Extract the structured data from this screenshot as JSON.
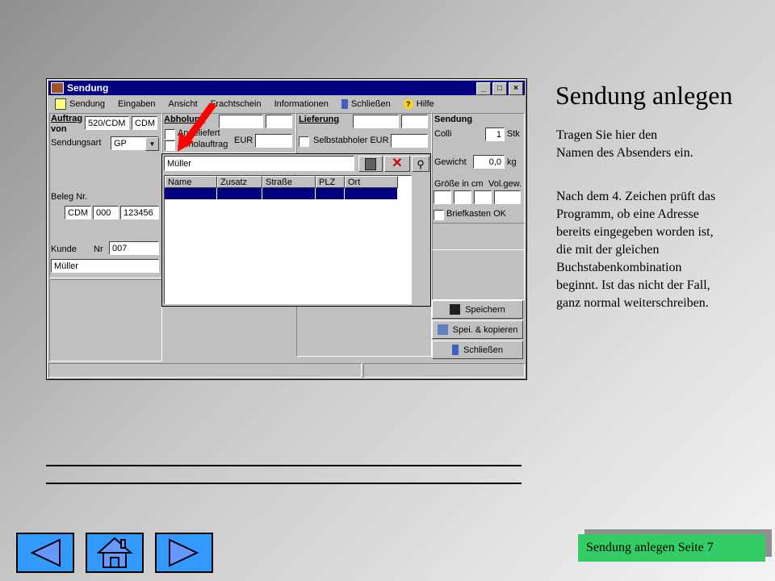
{
  "window": {
    "title": "Sendung",
    "controls": [
      "_",
      "□",
      "×"
    ],
    "menu": [
      {
        "label": "Sendung",
        "icon": "document-icon"
      },
      {
        "label": "Eingaben"
      },
      {
        "label": "Ansicht"
      },
      {
        "label": "Frachtschein"
      },
      {
        "label": "Informationen"
      },
      {
        "label": "Schließen",
        "icon": "door-icon"
      },
      {
        "label": "Hilfe",
        "icon": "help-icon"
      }
    ]
  },
  "auftrag": {
    "label_line1": "Auftrag",
    "label_line2": "von",
    "auftrag_nr": "520/CDM",
    "auftrag_code": "CDM",
    "sendungsart_label": "Sendungsart",
    "sendungsart_value": "GP",
    "beleg_label": "Beleg Nr.",
    "beleg_1": "CDM",
    "beleg_2": "000",
    "beleg_3": "123456",
    "kunde_label": "Kunde",
    "nr_label": "Nr",
    "kunde_nr": "007",
    "kunde_name": "Müller"
  },
  "abholung": {
    "label": "Abholung",
    "angeliefert": "Angeliefert",
    "abholauftrag": "Abholauftrag",
    "eur": "EUR"
  },
  "lieferung": {
    "label": "Lieferung",
    "selbstabholer": "Selbstabholer EUR"
  },
  "sendung": {
    "label": "Sendung",
    "colli_label": "Colli",
    "colli_value": "1",
    "stk": "Stk",
    "gewicht_label": "Gewicht",
    "gewicht_value": "0,0",
    "kg": "kg",
    "groesse_label": "Größe in cm",
    "volgew_label": "Vol.gew.",
    "briefkasten": "Briefkasten OK"
  },
  "buttons": {
    "speichern": "Speichern",
    "spei_kopieren": "Spei. & kopieren",
    "schliessen": "Schließen"
  },
  "popup": {
    "search_value": "Müller",
    "columns": [
      "Name",
      "Zusatz",
      "Straße",
      "PLZ",
      "Ort"
    ]
  },
  "slide": {
    "heading": "Sendung anlegen",
    "para1": "Tragen Sie hier den Namen des Absenders ein.",
    "para2": "Nach dem 4. Zeichen prüft das Programm, ob eine Adresse bereits eingegeben worden ist, die mit der gleichen Buchstabenkombination beginnt. Ist das nicht der Fall, ganz normal weiterschreiben.",
    "footer": "Sendung anlegen Seite 7"
  },
  "colors": {
    "titlebar": "#000080",
    "arrow": "#ff0000",
    "nav_button": "#3399ff",
    "footer_box": "#33cc66"
  }
}
